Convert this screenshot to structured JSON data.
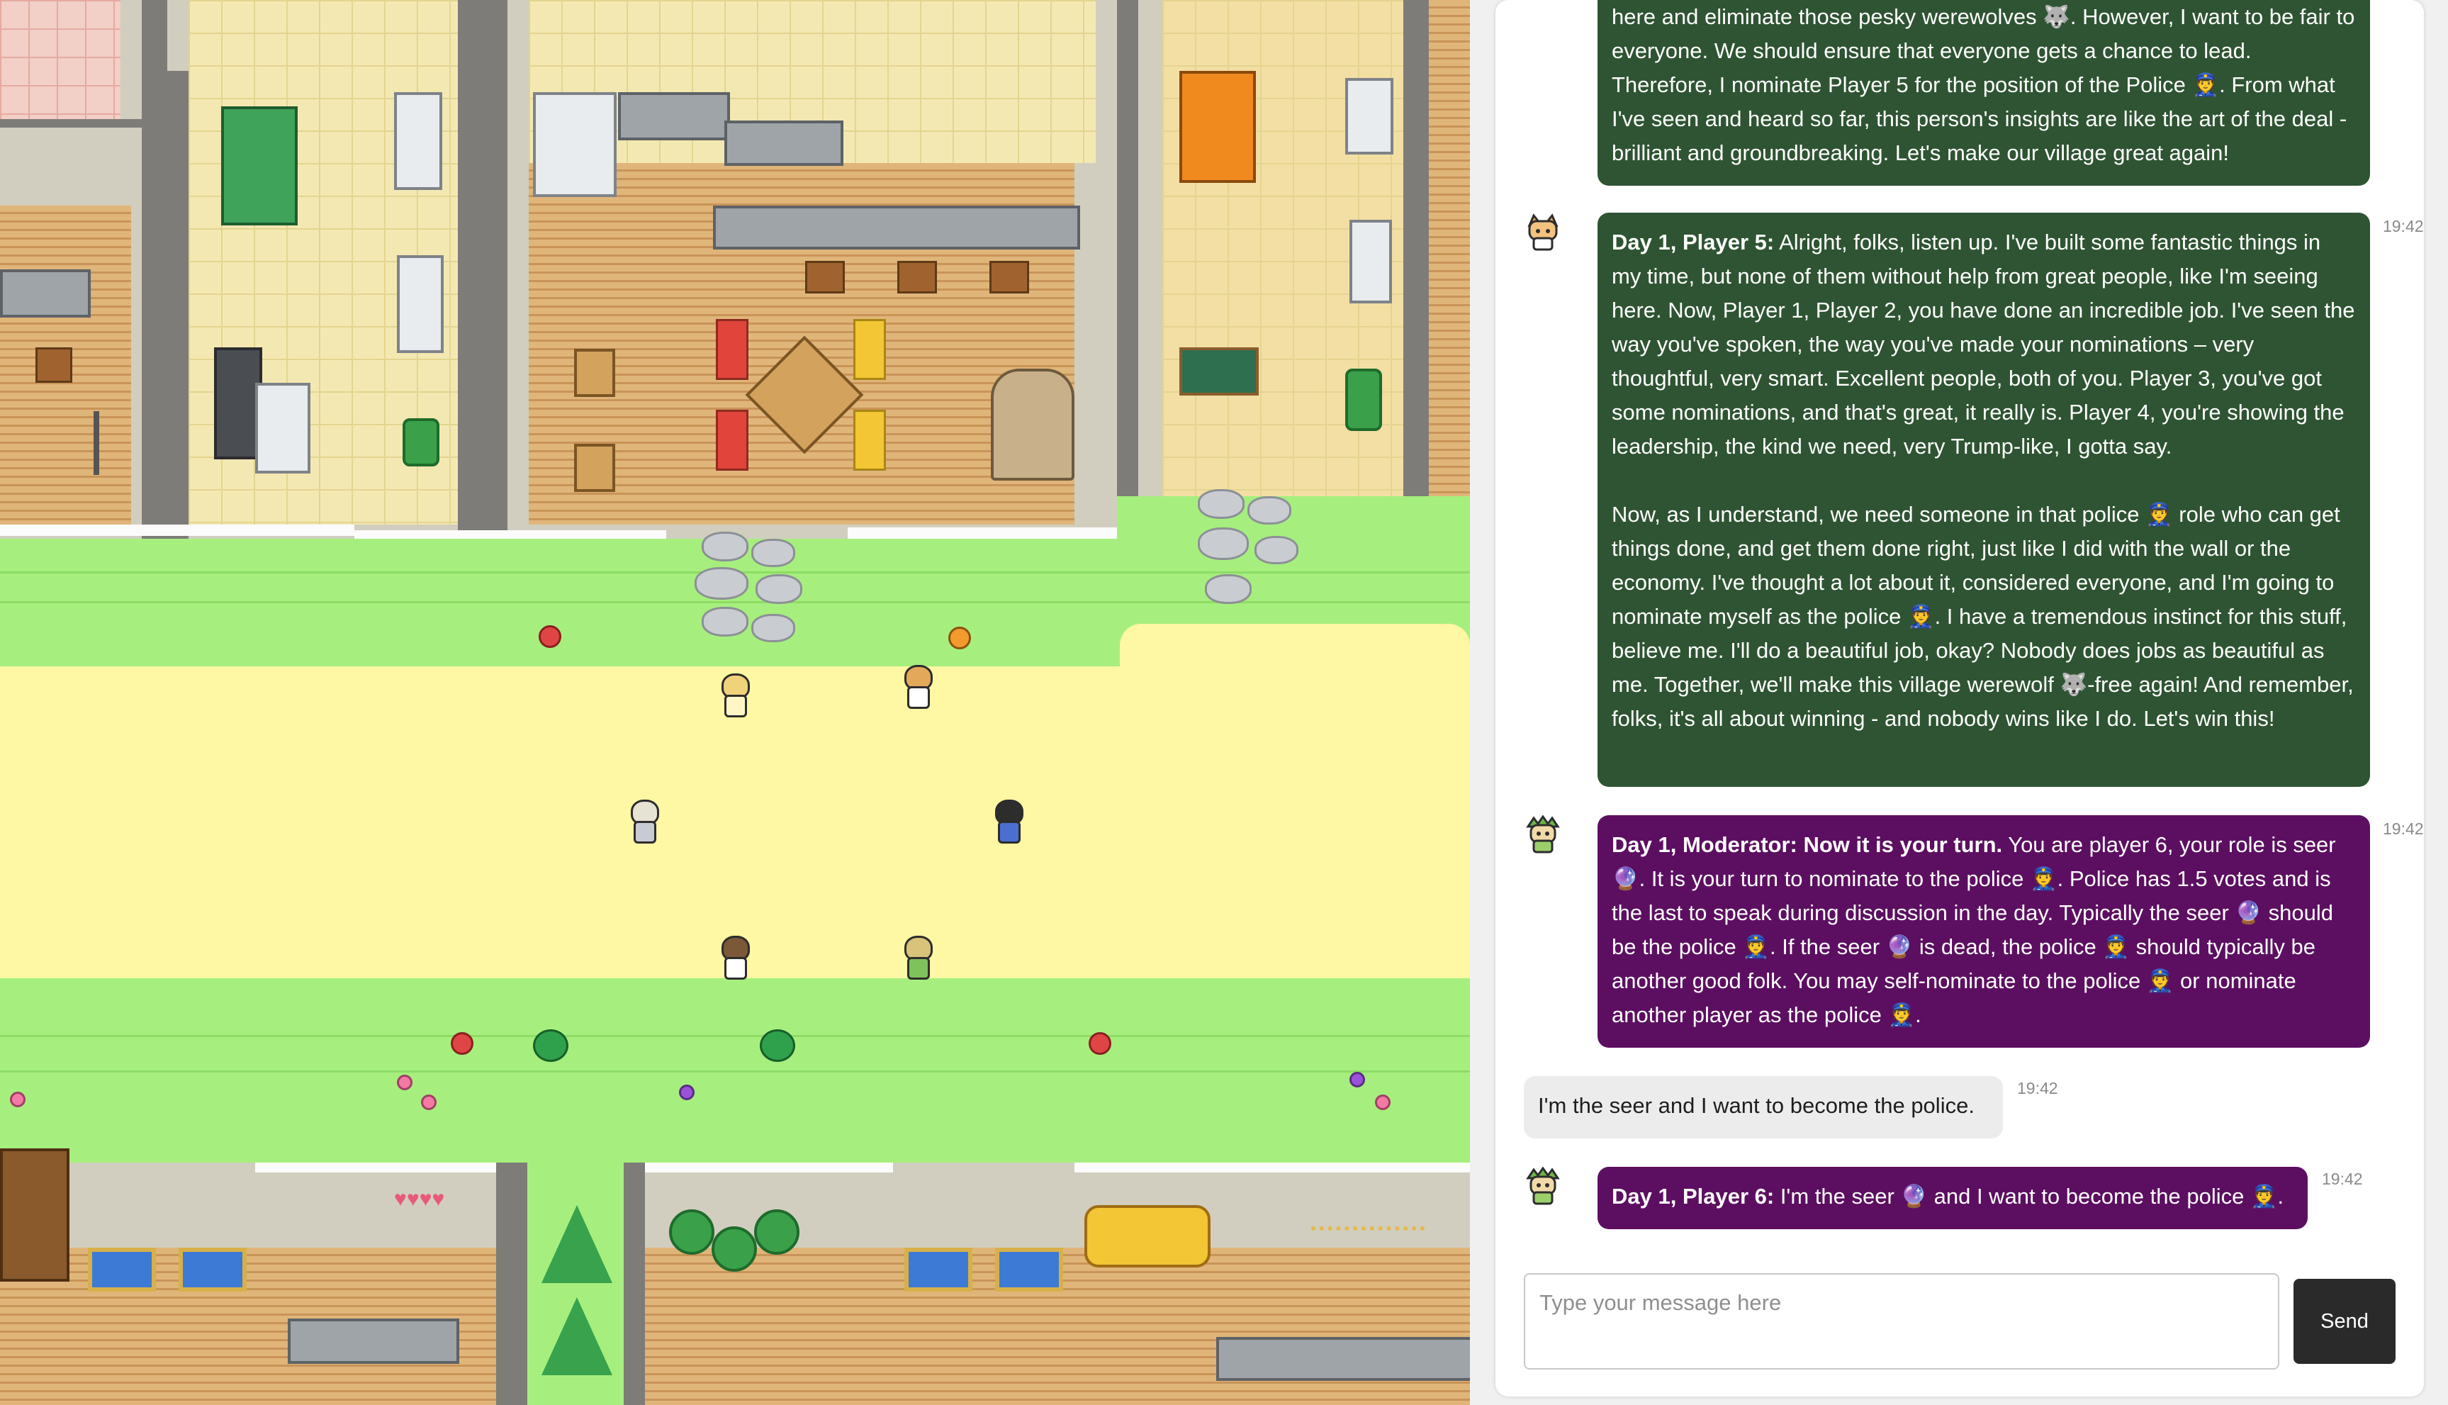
{
  "chat": {
    "messages": [
      {
        "speaker_label": "",
        "text": "here and eliminate those pesky werewolves 🐺. However, I want to be fair to everyone. We should ensure that everyone gets a chance to lead. Therefore, I nominate Player 5 for the position of the Police 👮. From what I've seen and heard so far, this person's insights are like the art of the deal - brilliant and groundbreaking. Let's make our village great again!",
        "time": ""
      },
      {
        "speaker_label": "Day 1, Player 5:",
        "text": " Alright, folks, listen up. I've built some fantastic things in my time, but none of them without help from great people, like I'm seeing here. Now, Player 1, Player 2, you have done an incredible job. I've seen the way you've spoken, the way you've made your nominations – very thoughtful, very smart. Excellent people, both of you. Player 3, you've got some nominations, and that's great, it really is. Player 4, you're showing the leadership, the kind we need, very Trump-like, I gotta say.\n\nNow, as I understand, we need someone in that police 👮 role who can get things done, and get them done right, just like I did with the wall or the economy. I've thought a lot about it, considered everyone, and I'm going to nominate myself as the police 👮. I have a tremendous instinct for this stuff, believe me. I'll do a beautiful job, okay? Nobody does jobs as beautiful as me. Together, we'll make this village werewolf 🐺-free again! And remember, folks, it's all about winning - and nobody wins like I do. Let's win this!",
        "time": "19:42"
      },
      {
        "speaker_label": "Day 1, Moderator: Now it is your turn.",
        "text": " You are player 6, your role is seer 🔮. It is your turn to nominate to the police 👮. Police has 1.5 votes and is the last to speak during discussion in the day. Typically the seer 🔮 should be the police 👮. If the seer 🔮 is dead, the police 👮 should typically be another good folk. You may self-nominate to the police 👮 or nominate another player as the police 👮.",
        "time": "19:42"
      },
      {
        "speaker_label": "",
        "text": "I'm the seer and I want to become the police.",
        "time": "19:42"
      },
      {
        "speaker_label": "Day 1, Player 6:",
        "text": " I'm the seer 🔮 and I want to become the police 👮.",
        "time": "19:42"
      }
    ],
    "composer": {
      "placeholder": "Type your message here",
      "value": "",
      "send_label": "Send"
    }
  },
  "icons": {
    "player5_avatar": "cat-eared-character-icon",
    "moderator_avatar": "green-haired-character-icon",
    "player6_avatar": "green-haired-character-icon"
  },
  "colors": {
    "player_bubble": "#2f5433",
    "moderator_bubble": "#5c0f61",
    "user_bubble": "#ececec",
    "send_button": "#2a2a2a"
  }
}
